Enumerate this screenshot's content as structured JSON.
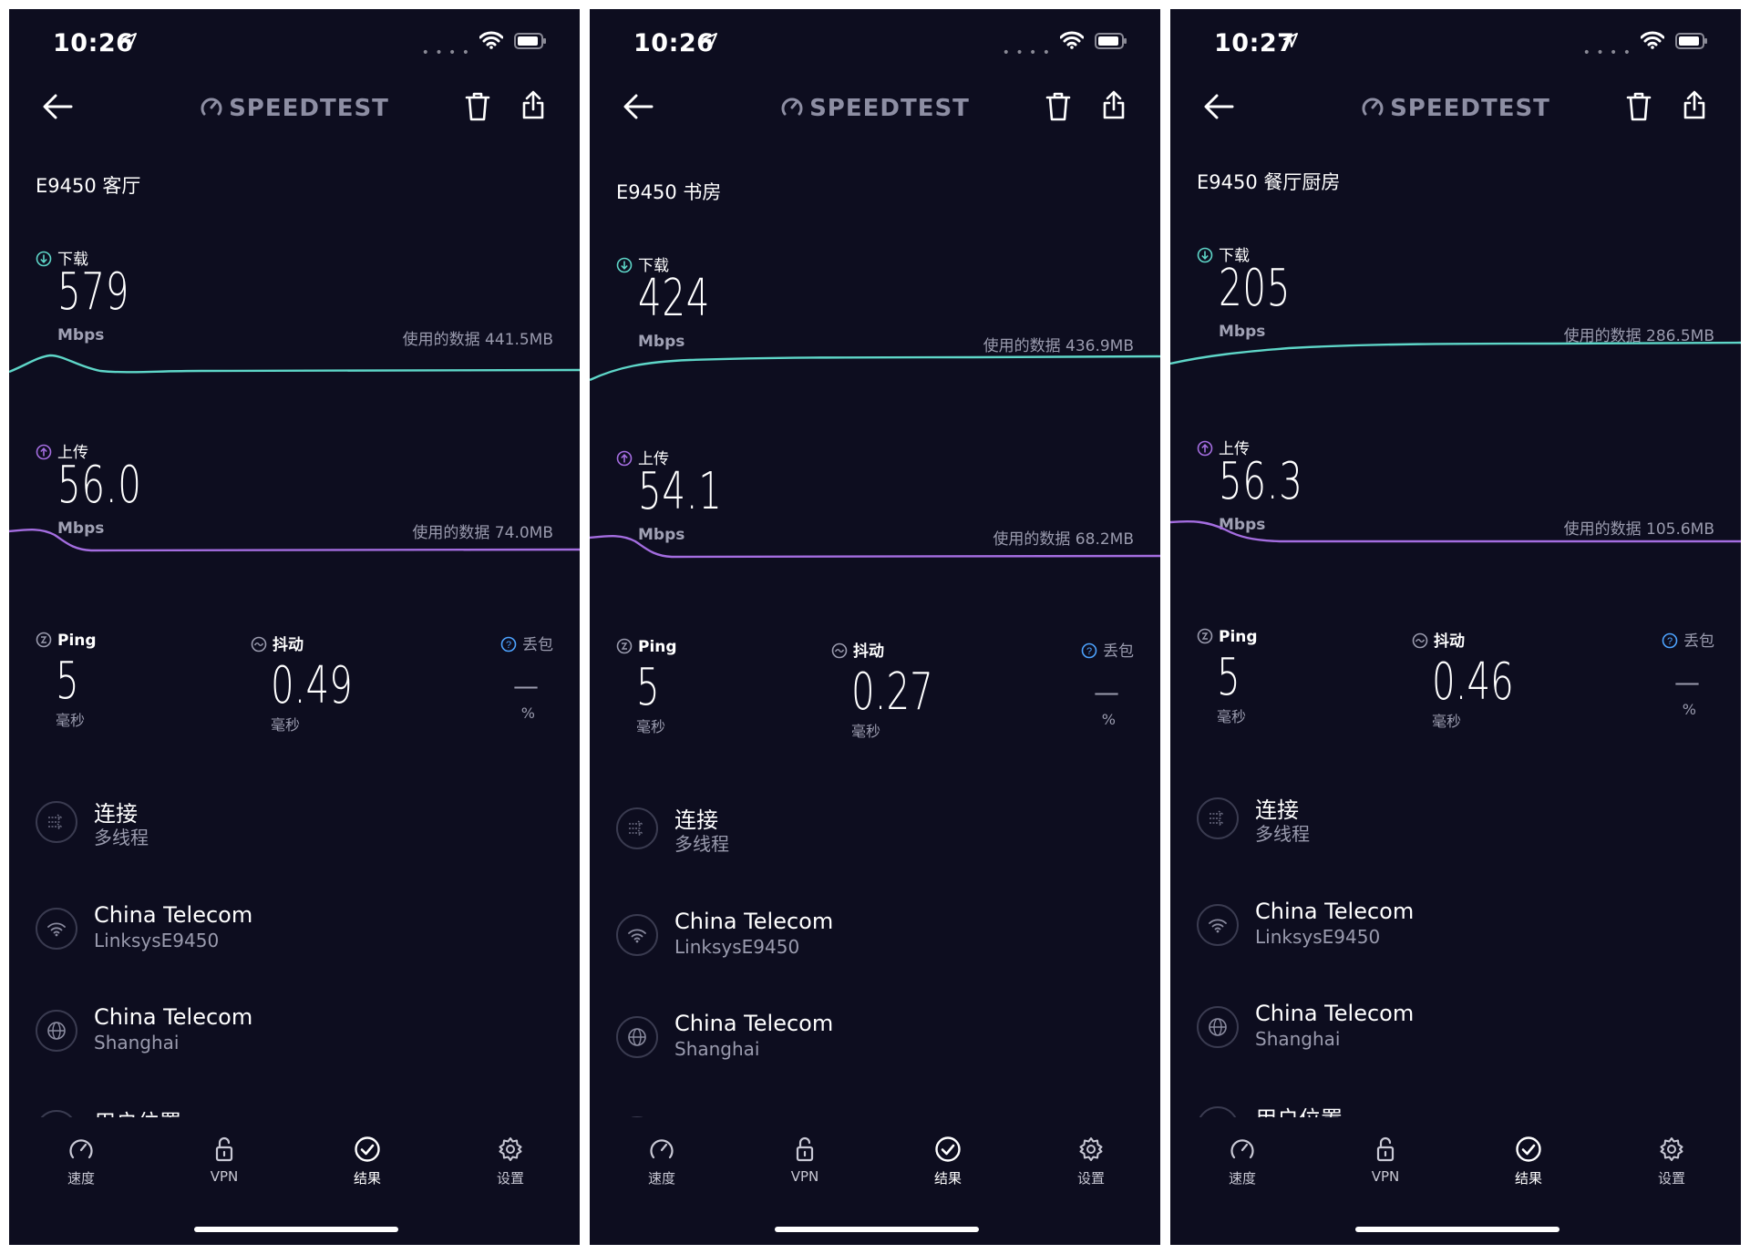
{
  "phones": [
    {
      "status": {
        "time": "10:26"
      },
      "nav": {
        "brand": "SPEEDTEST"
      },
      "title": "E9450 客厅",
      "download": {
        "label": "下载",
        "value": "579",
        "unit": "Mbps",
        "data_used": "使用的数据 441.5MB"
      },
      "upload": {
        "label": "上传",
        "value": "56.0",
        "unit": "Mbps",
        "data_used": "使用的数据 74.0MB"
      },
      "ping": {
        "label": "Ping",
        "value": "5",
        "unit": "毫秒"
      },
      "jitter": {
        "label": "抖动",
        "value": "0.49",
        "unit": "毫秒"
      },
      "packet_loss": {
        "label": "丢包",
        "value": "—",
        "unit": "%"
      },
      "connection": {
        "title": "连接",
        "sub": "多线程"
      },
      "network": {
        "title": "China Telecom",
        "sub": "LinksysE9450"
      },
      "server": {
        "title": "China Telecom",
        "sub": "Shanghai"
      },
      "location": {
        "title": "用户位置"
      },
      "tabs": [
        {
          "label": "速度"
        },
        {
          "label": "VPN"
        },
        {
          "label": "结果"
        },
        {
          "label": "设置"
        }
      ]
    },
    {
      "status": {
        "time": "10:26"
      },
      "nav": {
        "brand": "SPEEDTEST"
      },
      "title": "E9450 书房",
      "download": {
        "label": "下载",
        "value": "424",
        "unit": "Mbps",
        "data_used": "使用的数据 436.9MB"
      },
      "upload": {
        "label": "上传",
        "value": "54.1",
        "unit": "Mbps",
        "data_used": "使用的数据 68.2MB"
      },
      "ping": {
        "label": "Ping",
        "value": "5",
        "unit": "毫秒"
      },
      "jitter": {
        "label": "抖动",
        "value": "0.27",
        "unit": "毫秒"
      },
      "packet_loss": {
        "label": "丢包",
        "value": "—",
        "unit": "%"
      },
      "connection": {
        "title": "连接",
        "sub": "多线程"
      },
      "network": {
        "title": "China Telecom",
        "sub": "LinksysE9450"
      },
      "server": {
        "title": "China Telecom",
        "sub": "Shanghai"
      },
      "location": {
        "title": "用户位置"
      },
      "tabs": [
        {
          "label": "速度"
        },
        {
          "label": "VPN"
        },
        {
          "label": "结果"
        },
        {
          "label": "设置"
        }
      ]
    },
    {
      "status": {
        "time": "10:27"
      },
      "nav": {
        "brand": "SPEEDTEST"
      },
      "title": "E9450 餐厅厨房",
      "download": {
        "label": "下载",
        "value": "205",
        "unit": "Mbps",
        "data_used": "使用的数据 286.5MB"
      },
      "upload": {
        "label": "上传",
        "value": "56.3",
        "unit": "Mbps",
        "data_used": "使用的数据 105.6MB"
      },
      "ping": {
        "label": "Ping",
        "value": "5",
        "unit": "毫秒"
      },
      "jitter": {
        "label": "抖动",
        "value": "0.46",
        "unit": "毫秒"
      },
      "packet_loss": {
        "label": "丢包",
        "value": "—",
        "unit": "%"
      },
      "connection": {
        "title": "连接",
        "sub": "多线程"
      },
      "network": {
        "title": "China Telecom",
        "sub": "LinksysE9450"
      },
      "server": {
        "title": "China Telecom",
        "sub": "Shanghai"
      },
      "location": {
        "title": "用户位置"
      },
      "tabs": [
        {
          "label": "速度"
        },
        {
          "label": "VPN"
        },
        {
          "label": "结果"
        },
        {
          "label": "设置"
        }
      ]
    }
  ],
  "colors": {
    "background": "#0d0d1f",
    "download": "#5ed6c8",
    "upload": "#a46de0",
    "muted": "#9a9bae"
  }
}
